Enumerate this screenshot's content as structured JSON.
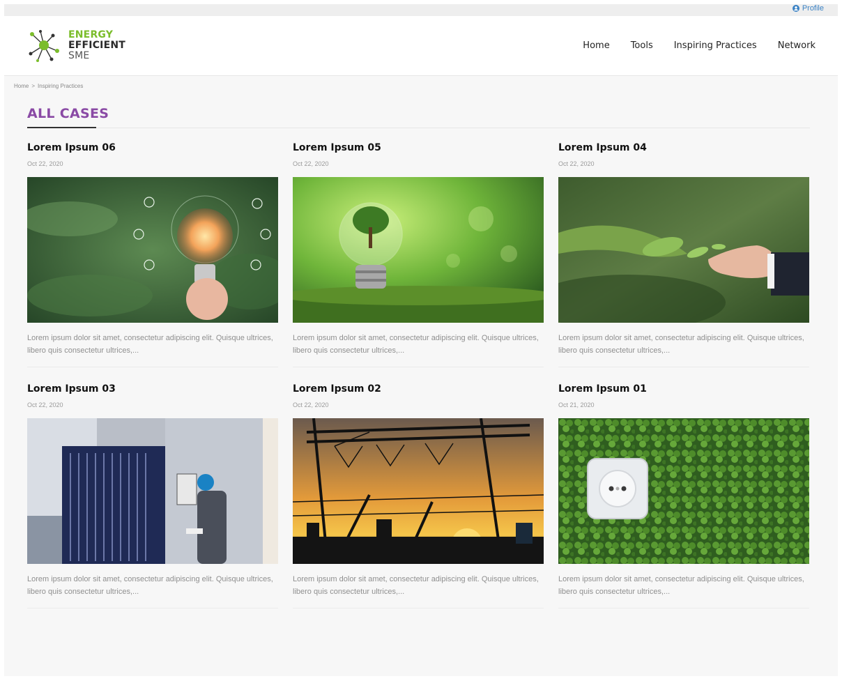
{
  "topbar": {
    "profile_label": "Profile"
  },
  "logo": {
    "line1": "ENERGY",
    "line2": "EFFICIENT",
    "line3": "SME"
  },
  "nav": {
    "items": [
      "Home",
      "Tools",
      "Inspiring Practices",
      "Network"
    ]
  },
  "breadcrumb": {
    "home": "Home",
    "separator": ">",
    "current": "Inspiring Practices"
  },
  "section": {
    "title": "ALL CASES"
  },
  "cards": [
    {
      "title": "Lorem Ipsum 06",
      "date": "Oct 22, 2020",
      "excerpt": "Lorem ipsum dolor sit amet, consectetur adipiscing elit. Quisque ultrices, libero quis consectetur ultrices,..."
    },
    {
      "title": "Lorem Ipsum 05",
      "date": "Oct 22, 2020",
      "excerpt": "Lorem ipsum dolor sit amet, consectetur adipiscing elit. Quisque ultrices, libero quis consectetur ultrices,..."
    },
    {
      "title": "Lorem Ipsum 04",
      "date": "Oct 22, 2020",
      "excerpt": "Lorem ipsum dolor sit amet, consectetur adipiscing elit. Quisque ultrices, libero quis consectetur ultrices,..."
    },
    {
      "title": "Lorem Ipsum 03",
      "date": "Oct 22, 2020",
      "excerpt": "Lorem ipsum dolor sit amet, consectetur adipiscing elit. Quisque ultrices, libero quis consectetur ultrices,..."
    },
    {
      "title": "Lorem Ipsum 02",
      "date": "Oct 22, 2020",
      "excerpt": "Lorem ipsum dolor sit amet, consectetur adipiscing elit. Quisque ultrices, libero quis consectetur ultrices,..."
    },
    {
      "title": "Lorem Ipsum 01",
      "date": "Oct 21, 2020",
      "excerpt": "Lorem ipsum dolor sit amet, consectetur adipiscing elit. Quisque ultrices, libero quis consectetur ultrices,..."
    }
  ],
  "colors": {
    "accent_purple": "#8a4aa5",
    "brand_green": "#7bbd2b",
    "link_blue": "#3b82c4"
  }
}
